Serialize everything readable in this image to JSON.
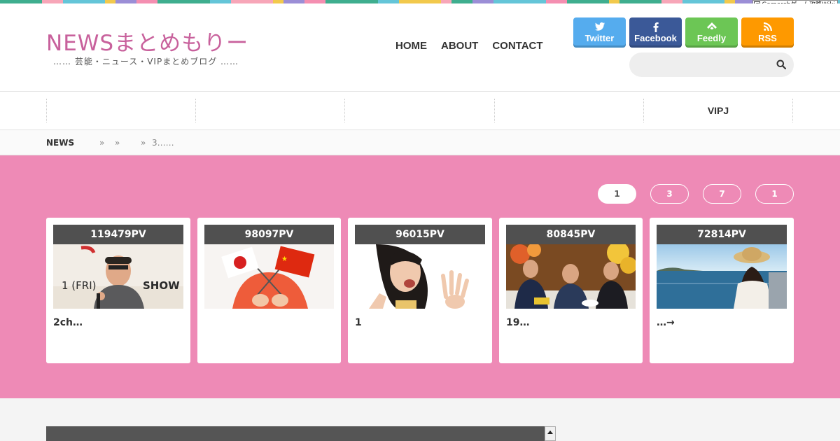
{
  "badge": {
    "text": "Gamerchゲーム攻略Wiki"
  },
  "site": {
    "logo": "NEWSまとめもりー",
    "tagline": "…… 芸能・ニュース・VIPまとめブログ ……"
  },
  "nav": {
    "home": "HOME",
    "about": "ABOUT",
    "contact": "CONTACT"
  },
  "social": [
    {
      "label": "Twitter",
      "icon": "twitter-icon",
      "glyph": "♦",
      "color": "#55acee"
    },
    {
      "label": "Facebook",
      "icon": "facebook-icon",
      "glyph": "f",
      "color": "#3b5998"
    },
    {
      "label": "Feedly",
      "icon": "feedly-icon",
      "glyph": "◆",
      "color": "#6cc655"
    },
    {
      "label": "RSS",
      "icon": "rss-icon",
      "glyph": "◗",
      "color": "#fe9900"
    }
  ],
  "search": {
    "placeholder": ""
  },
  "categories": [
    "",
    "",
    "",
    "",
    "VIPJ"
  ],
  "breadcrumb": {
    "home": "NEWS",
    "sep1": "»",
    "sep2": "»",
    "sep3": "»",
    "current": "3……"
  },
  "tabs": [
    "1",
    "3",
    "7",
    "1"
  ],
  "cards": [
    {
      "pv": "119479PV",
      "title": "2ch…"
    },
    {
      "pv": "98097PV",
      "title": ""
    },
    {
      "pv": "96015PV",
      "title": "1"
    },
    {
      "pv": "80845PV",
      "title": "19…"
    },
    {
      "pv": "72814PV",
      "title": "…→"
    }
  ],
  "colors": {
    "accent": "#ee8ab6",
    "logo": "#c8619c",
    "pv_bg": "#505050"
  }
}
